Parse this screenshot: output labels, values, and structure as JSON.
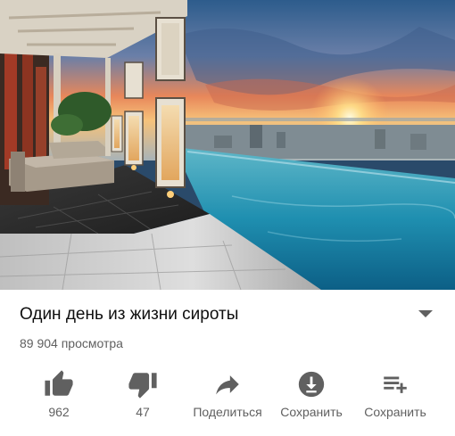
{
  "video": {
    "title": "Один день из жизни сироты",
    "views": "89 904 просмотра"
  },
  "actions": [
    {
      "icon": "thumb-up-icon",
      "label": "962"
    },
    {
      "icon": "thumb-down-icon",
      "label": "47"
    },
    {
      "icon": "share-icon",
      "label": "Поделиться"
    },
    {
      "icon": "download-icon",
      "label": "Сохранить"
    },
    {
      "icon": "playlist-add-icon",
      "label": "Сохранить"
    }
  ],
  "colors": {
    "icon": "#606060",
    "text": "#0f0f0f",
    "secondary_text": "#606060"
  }
}
